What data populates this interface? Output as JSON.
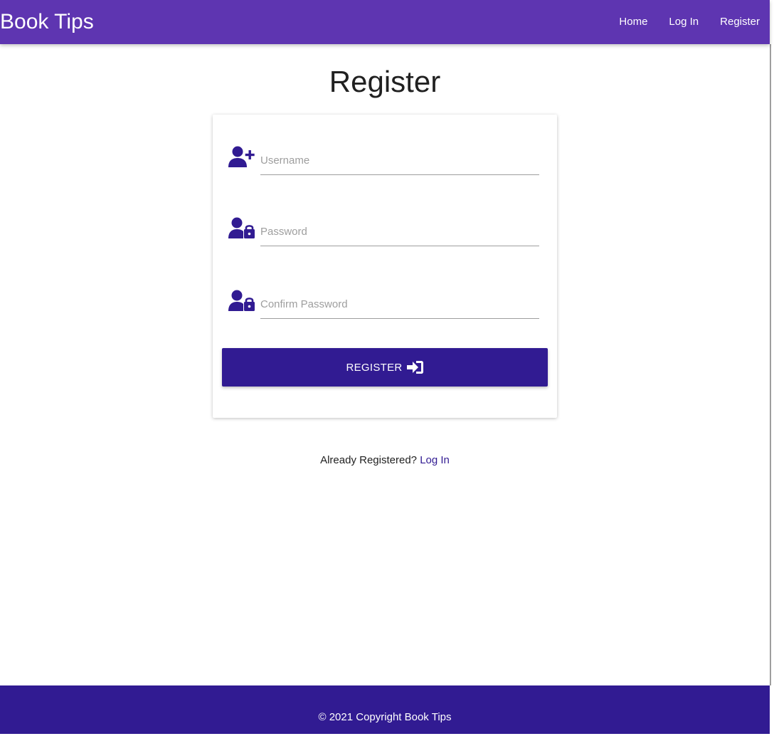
{
  "navbar": {
    "brand": "Book Tips",
    "links": [
      {
        "label": "Home"
      },
      {
        "label": "Log In"
      },
      {
        "label": "Register"
      }
    ],
    "background": "#5e35b1"
  },
  "page": {
    "title": "Register"
  },
  "form": {
    "username": {
      "placeholder": "Username",
      "value": "",
      "icon": "user-plus-icon"
    },
    "password": {
      "placeholder": "Password",
      "value": "",
      "icon": "user-lock-icon"
    },
    "confirm_password": {
      "placeholder": "Confirm Password",
      "value": "",
      "icon": "user-lock-icon"
    },
    "submit_label": "REGISTER",
    "submit_icon": "sign-in-icon",
    "accent": "#311b92"
  },
  "login_prompt": {
    "text": "Already Registered?",
    "link": "Log In"
  },
  "footer": {
    "text": "© 2021 Copyright Book Tips",
    "background": "#311b92"
  }
}
